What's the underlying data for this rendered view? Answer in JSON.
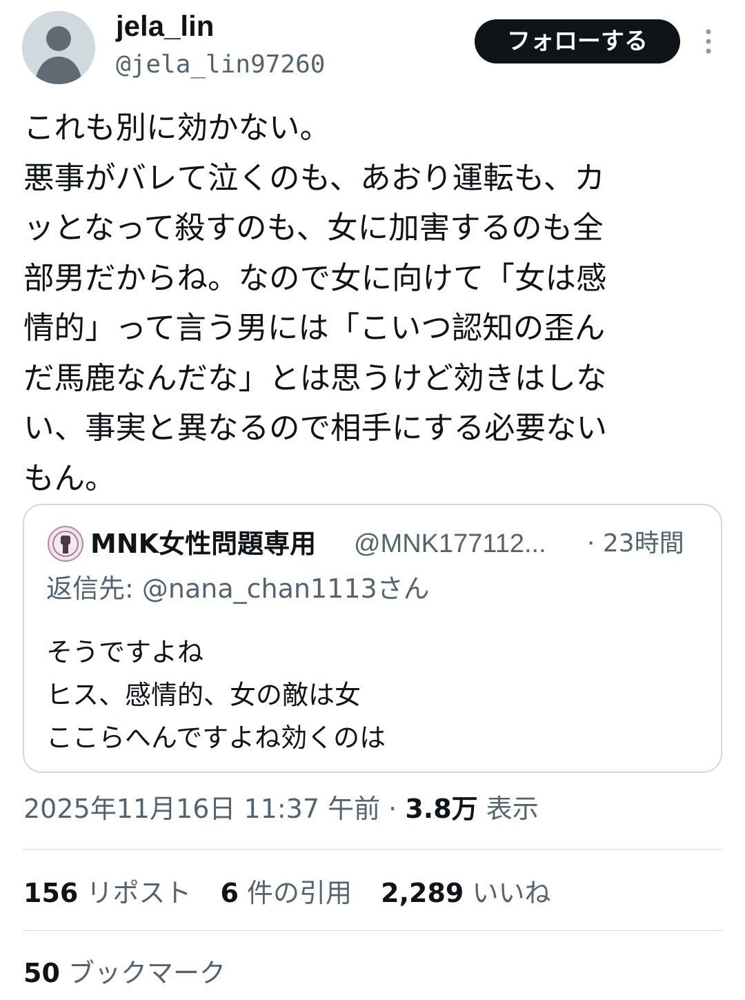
{
  "author": {
    "display_name": "jela_lin",
    "handle": "@jela_lin97260",
    "follow_label": "フォローする"
  },
  "tweet": {
    "lines": [
      "これも別に効かない。",
      "悪事がバレて泣くのも、あおり運転も、カ",
      "ッとなって殺すのも、女に加害するのも全",
      "部男だからね。なので女に向けて「女は感",
      "情的」って言う男には「こいつ認知の歪ん",
      "だ馬鹿なんだな」とは思うけど効きはしな",
      "い、事実と異なるので相手にする必要ない",
      "もん。"
    ]
  },
  "quote": {
    "display_name": "MNK女性問題専用",
    "handle": "@MNK177112...",
    "time": "· 23時間",
    "reply_to": "返信先: @nana_chan1113さん",
    "lines": [
      "そうですよね",
      "ヒス、感情的、女の敵は女",
      "ここらへんですよね効くのは"
    ]
  },
  "meta": {
    "timestamp": "2025年11月16日 11:37 午前 · ",
    "views_count": "3.8万",
    "views_label": " 表示"
  },
  "stats": {
    "reposts": {
      "count": "156",
      "label": " リポスト"
    },
    "quotes": {
      "count": "6",
      "label": " 件の引用"
    },
    "likes": {
      "count": "2,289",
      "label": " いいね"
    },
    "bookmarks": {
      "count": "50",
      "label": " ブックマーク"
    }
  },
  "icons": {
    "avatar": "default-avatar-icon",
    "more": "more-vertical-icon",
    "quote_avatar": "raised-fist-avatar-icon"
  },
  "colors": {
    "text_primary": "#0f1419",
    "text_secondary": "#536471",
    "border": "#cfd9de",
    "button_bg": "#0f1419"
  }
}
